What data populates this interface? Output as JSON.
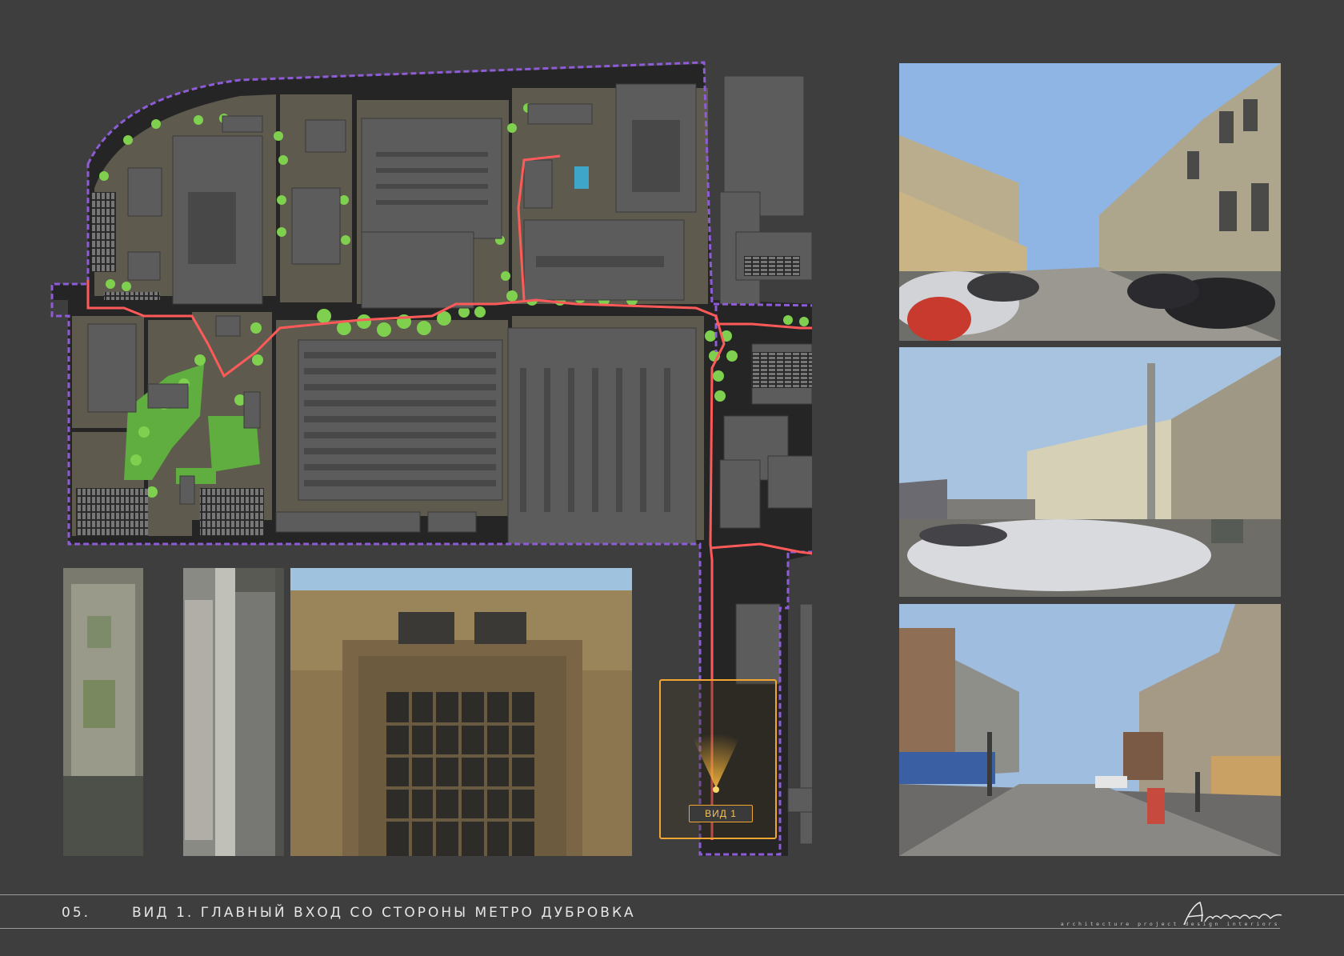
{
  "footer": {
    "page_number": "05.",
    "caption": "ВИД 1. ГЛАВНЫЙ ВХОД СО СТОРОНЫ МЕТРО ДУБРОВКА",
    "logo_text": "Archigraph",
    "logo_subtitle": "architecture  project  design  interiors"
  },
  "map": {
    "view_label": "ВИД 1",
    "colors": {
      "site": "#5c5950",
      "road": "#262626",
      "building": "#5a5a5a",
      "green": "#6cc24a",
      "route": "#ff5a5a",
      "boundary": "#8e5cd6",
      "highlight": "#f2a531"
    },
    "legend_icons": [
      "boundary-line",
      "pedestrian-route",
      "view-frame"
    ]
  },
  "photos": [
    {
      "name": "photo-aerial",
      "subject": "aerial-view"
    },
    {
      "name": "photo-facade",
      "subject": "brick-facade-window"
    },
    {
      "name": "photo-street-1",
      "subject": "street-parking"
    },
    {
      "name": "photo-street-2",
      "subject": "factory-wall"
    },
    {
      "name": "photo-street-3",
      "subject": "entrance-gate"
    }
  ]
}
